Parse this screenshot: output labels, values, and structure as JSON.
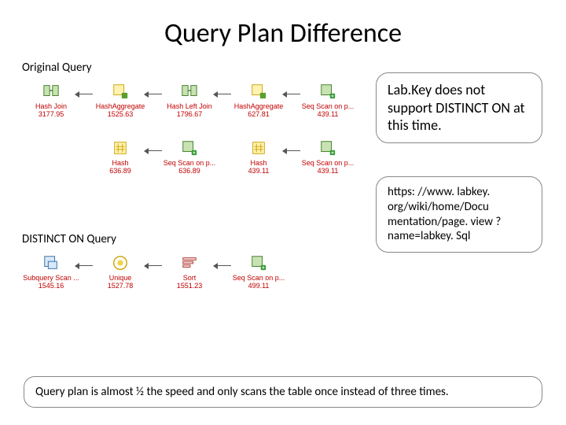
{
  "title": "Query Plan Difference",
  "original": {
    "heading": "Original Query",
    "row1": [
      {
        "label": "Hash Join",
        "cost": "3177.95",
        "icon": "hash-join"
      },
      {
        "label": "HashAggregate",
        "cost": "1525.63",
        "icon": "hash-agg"
      },
      {
        "label": "Hash Left Join",
        "cost": "1796.67",
        "icon": "hash-join"
      },
      {
        "label": "HashAggregate",
        "cost": "627.81",
        "icon": "hash-agg"
      },
      {
        "label": "Seq Scan on p...",
        "cost": "439.11",
        "icon": "seq-scan"
      }
    ],
    "row2": [
      {
        "label": "Hash",
        "cost": "636.89",
        "icon": "hash"
      },
      {
        "label": "Seq Scan on p...",
        "cost": "636.89",
        "icon": "seq-scan"
      },
      {
        "label": "Hash",
        "cost": "439.11",
        "icon": "hash"
      },
      {
        "label": "Seq Scan on p...",
        "cost": "439.11",
        "icon": "seq-scan"
      }
    ]
  },
  "distinct": {
    "heading": "DISTINCT ON Query",
    "row": [
      {
        "label": "Subquery Scan ...",
        "cost": "1545.16",
        "icon": "subquery"
      },
      {
        "label": "Unique",
        "cost": "1527.78",
        "icon": "unique"
      },
      {
        "label": "Sort",
        "cost": "1551.23",
        "icon": "sort"
      },
      {
        "label": "Seq Scan on p...",
        "cost": "499.11",
        "icon": "seq-scan"
      }
    ]
  },
  "callout1": "Lab.Key does not support DISTINCT ON at this time.",
  "callout2": "https: //www. labkey. org/wiki/home/Docu mentation/page. view ? name=labkey. Sql",
  "footer": "Query plan is almost ½ the speed and only scans the table once instead of three times."
}
